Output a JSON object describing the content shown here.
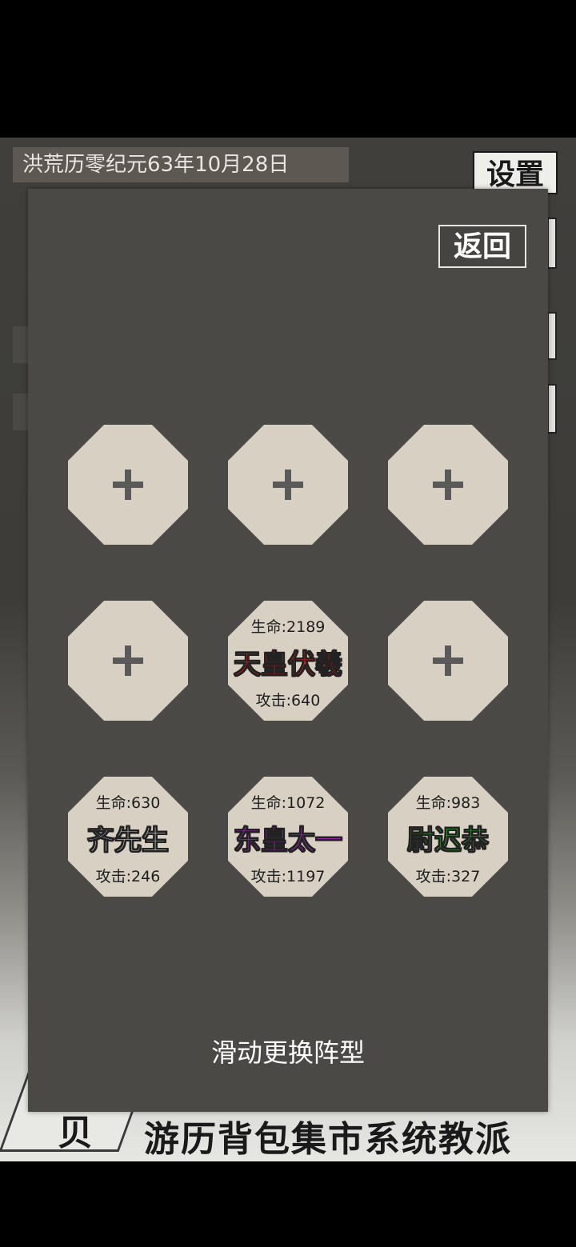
{
  "header": {
    "date": "洪荒历零纪元63年10月28日",
    "settings_label": "设置"
  },
  "bottom_nav": {
    "left_char": "贝",
    "items": [
      "游历",
      "背包",
      "集市",
      "系统",
      "教派"
    ]
  },
  "formation_dialog": {
    "back_label": "返回",
    "hint": "滑动更换阵型",
    "slots": [
      {
        "empty": true
      },
      {
        "empty": true
      },
      {
        "empty": true
      },
      {
        "empty": true
      },
      {
        "empty": false,
        "name": "天皇伏羲",
        "hp": "生命:2189",
        "atk": "攻击:640",
        "name_color": "#e0201a"
      },
      {
        "empty": true
      },
      {
        "empty": false,
        "name": "齐先生",
        "hp": "生命:630",
        "atk": "攻击:246",
        "name_color": "#f0f0f0"
      },
      {
        "empty": false,
        "name": "东皇太一",
        "hp": "生命:1072",
        "atk": "攻击:1197",
        "name_color": "#c02ad8"
      },
      {
        "empty": false,
        "name": "尉迟恭",
        "hp": "生命:983",
        "atk": "攻击:327",
        "name_color": "#3bd63a"
      }
    ],
    "plus_icon": "plus-icon"
  }
}
